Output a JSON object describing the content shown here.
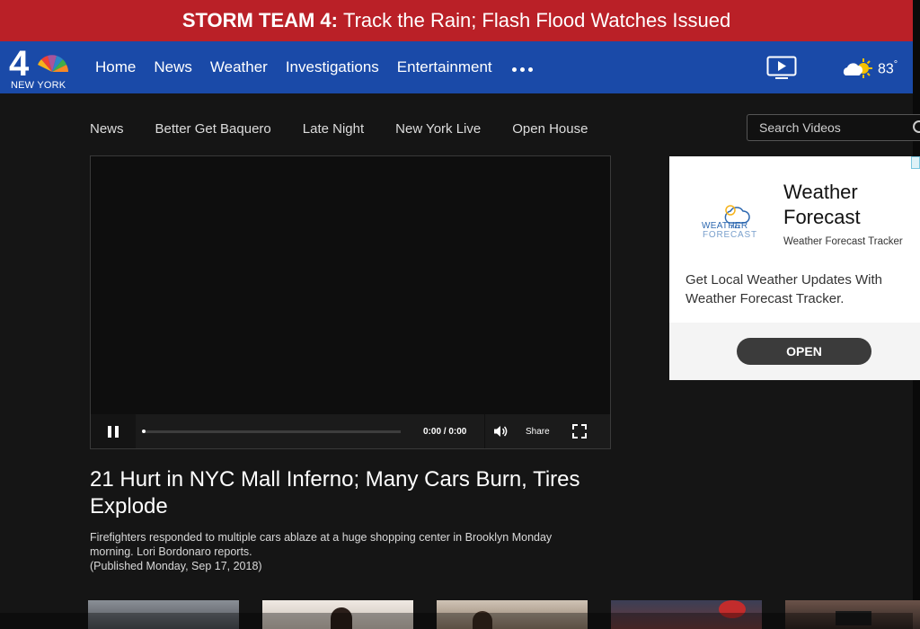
{
  "alert": {
    "label": "STORM TEAM 4:",
    "text": "Track the Rain; Flash Flood Watches Issued"
  },
  "brand": {
    "logo_text": "NEW YORK",
    "logo_number": "4",
    "color_alert": "#ba2027",
    "color_nav": "#1a4aa8"
  },
  "nav": {
    "items": [
      {
        "label": "Home"
      },
      {
        "label": "News"
      },
      {
        "label": "Weather"
      },
      {
        "label": "Investigations"
      },
      {
        "label": "Entertainment"
      }
    ],
    "more_icon": "ellipsis-icon",
    "tv_icon": "tv-play-icon",
    "weather": {
      "icon": "partly-sunny-icon",
      "temperature": "83",
      "unit": "°"
    }
  },
  "subnav": {
    "items": [
      {
        "label": "News"
      },
      {
        "label": "Better Get Baquero"
      },
      {
        "label": "Late Night"
      },
      {
        "label": "New York Live"
      },
      {
        "label": "Open House"
      }
    ],
    "search_placeholder": "Search Videos"
  },
  "player": {
    "time": "0:00 / 0:00",
    "share_label": "Share",
    "progress": 0
  },
  "video": {
    "title": "21 Hurt in NYC Mall Inferno; Many Cars Burn, Tires Explode",
    "description": "Firefighters responded to multiple cars ablaze at a huge shopping center in Brooklyn Monday morning. Lori Bordonaro reports.",
    "published": "(Published Monday, Sep 17, 2018)"
  },
  "ad": {
    "logo_line1": "WEATHER",
    "logo_line2": "FORECAST",
    "title": "Weather Forecast",
    "subtitle": "Weather Forecast Tracker",
    "body": "Get Local Weather Updates With Weather Forecast Tracker.",
    "cta": "OPEN"
  },
  "thumbnails": [
    {
      "name": "thumb-1"
    },
    {
      "name": "thumb-2"
    },
    {
      "name": "thumb-3"
    },
    {
      "name": "thumb-4"
    },
    {
      "name": "thumb-5"
    }
  ]
}
